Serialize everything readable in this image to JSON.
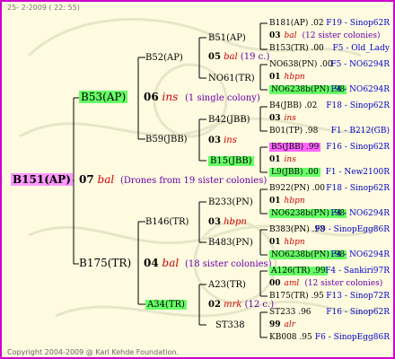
{
  "stamp": "25-  2-2009 ( 22: 55)",
  "copyright": "Copyright 2004-2009 @ Karl Kehde Foundation.",
  "root": {
    "id": "B151(AP)",
    "gen": "07",
    "ins": "bal",
    "note": "(Drones from 19 sister colonies)"
  },
  "g1": [
    {
      "id": "B53(AP)",
      "gen": "06",
      "ins": "ins",
      "note": "(1 single colony)"
    },
    {
      "id": "B175(TR)",
      "gen": "04",
      "ins": "bal",
      "note": "(18 sister colonies)"
    }
  ],
  "g2": [
    {
      "id": "B52(AP)"
    },
    {
      "id": "B59(JBB)"
    },
    {
      "id": "B146(TR)"
    },
    {
      "id": "A34(TR)"
    }
  ],
  "g3": [
    {
      "id": "B51(AP)",
      "gen": "05",
      "ins": "bal",
      "note": "(19 c.)"
    },
    {
      "id": "NO61(TR)"
    },
    {
      "id": "B42(JBB)"
    },
    {
      "id": "03",
      "ins": "ins"
    },
    {
      "id": "B15(JBB)"
    },
    {
      "id": "B233(PN)"
    },
    {
      "id": "03",
      "ins": "hbpn"
    },
    {
      "id": "B483(PN)"
    },
    {
      "id": "A23(TR)"
    },
    {
      "id": "02",
      "ins": "mrk",
      "note": "(12 c.)"
    },
    {
      "id": "ST338"
    }
  ],
  "g4": [
    {
      "text": "B181(AP) .02",
      "src": "F19 - Sinop62R"
    },
    {
      "text": "03",
      "ins": "bal",
      "note": "(12 sister colonies)"
    },
    {
      "text": "B153(TR) .00",
      "src": "F5 - Old_Lady"
    },
    {
      "text": "NO638(PN) .00",
      "src": "F5 - NO6294R"
    },
    {
      "text": "01",
      "ins": "hbpn"
    },
    {
      "text": "NO6238b(PN) .98",
      "src": "F4 - NO6294R"
    },
    {
      "text": "B4(JBB) .02",
      "src": "F18 - Sinop62R"
    },
    {
      "text": "03",
      "ins": "ins"
    },
    {
      "text": "B01(TP) .98",
      "src": "F1 - B212(GB)"
    },
    {
      "text": "B5(JBB) .99",
      "src": "F16 - Sinop62R"
    },
    {
      "text": "01",
      "ins": "ins"
    },
    {
      "text": "L9(JBB) .00",
      "src": "F1 - New2100R"
    },
    {
      "text": "B922(PN) .00",
      "src": "F18 - Sinop62R"
    },
    {
      "text": "01",
      "ins": "hbpn"
    },
    {
      "text": "NO6238b(PN) .98",
      "src": "F4 - NO6294R"
    },
    {
      "text": "B383(PN) .98",
      "src": "F9 - SinopEgg86R"
    },
    {
      "text": "01",
      "ins": "hbpn"
    },
    {
      "text": "NO6238b(PN) .98",
      "src": "F4 - NO6294R"
    },
    {
      "text": "A126(TR) .99",
      "src": "F4 - Sankiri97R"
    },
    {
      "text": "00",
      "ins": "aml",
      "note": "(12 sister colonies)"
    },
    {
      "text": "B175(TR) .95",
      "src": "F13 - Sinop72R"
    },
    {
      "text": "ST233 .96",
      "src": "F16 - Sinop62R"
    },
    {
      "text": "99",
      "ins": "alr"
    },
    {
      "text": "KB008 .95",
      "src": "F6 - SinopEgg86R"
    }
  ]
}
